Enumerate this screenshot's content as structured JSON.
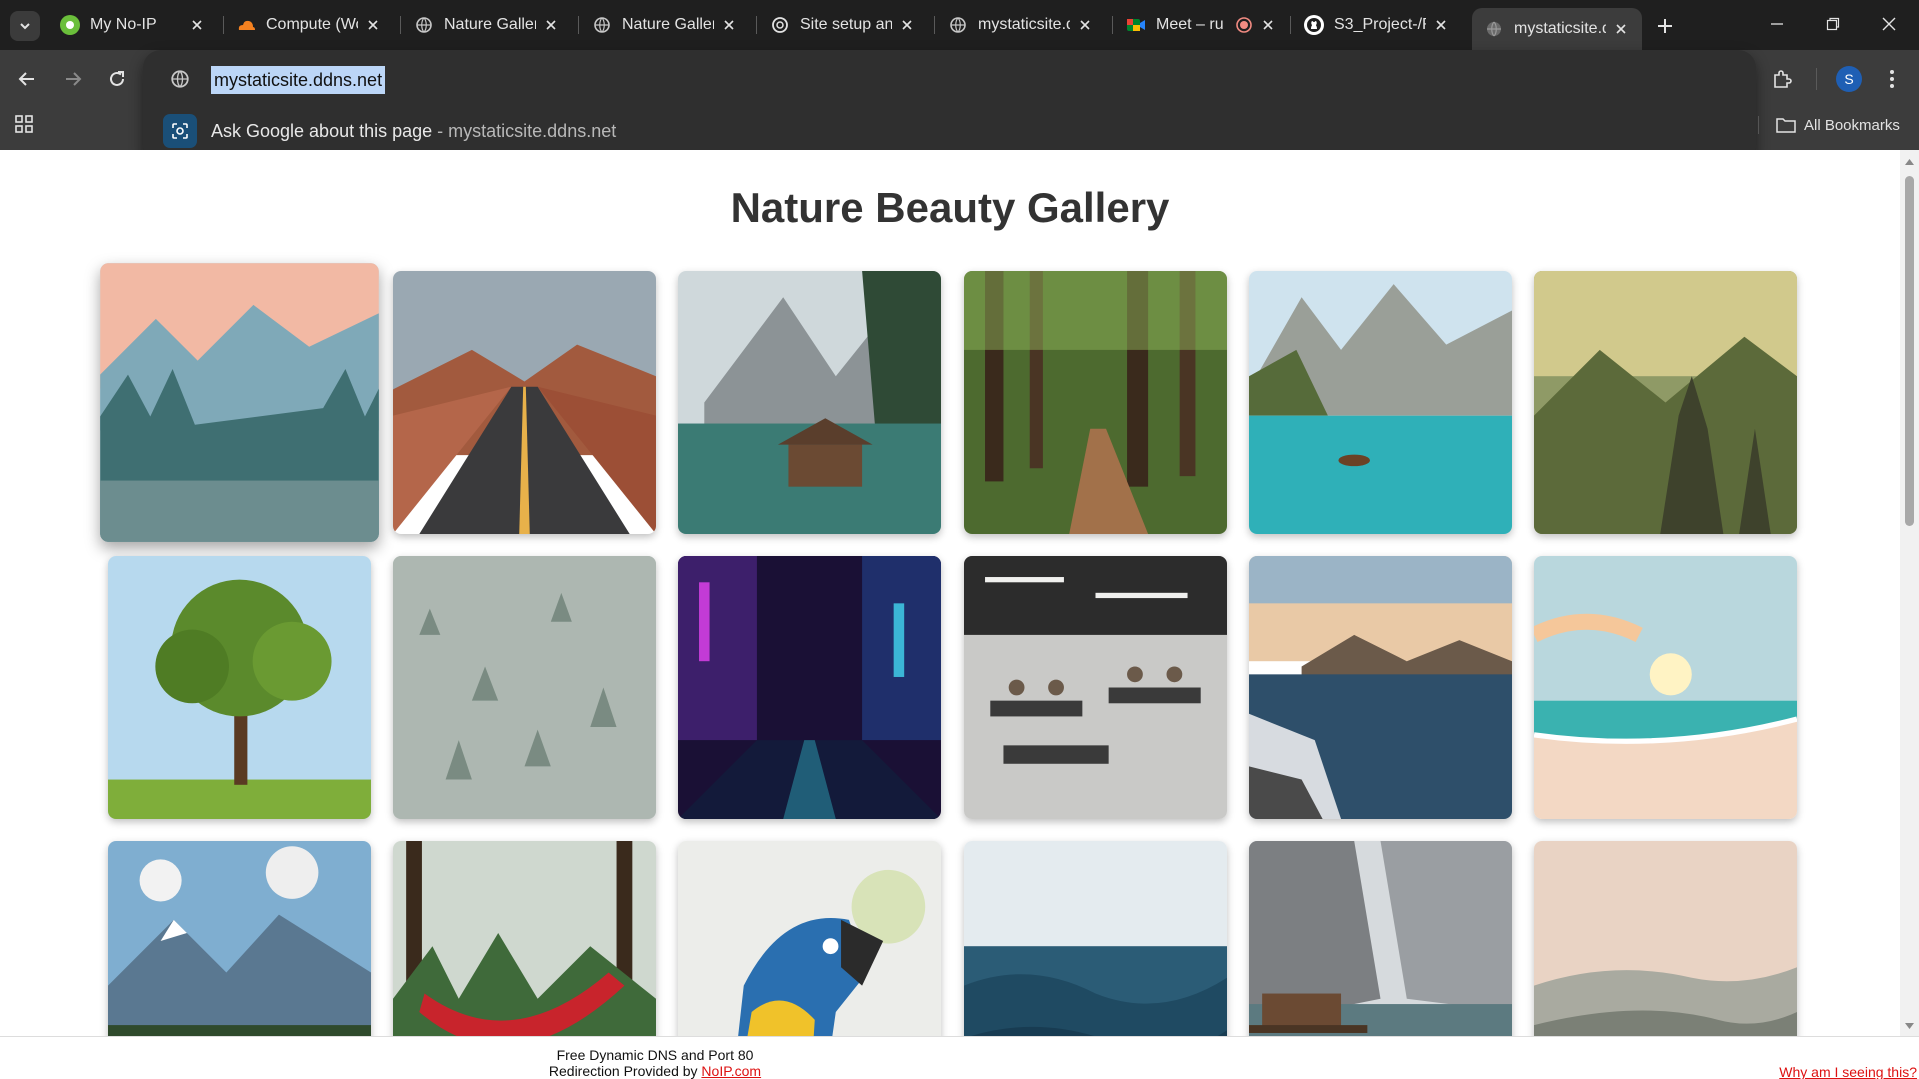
{
  "browser": {
    "tabs": [
      {
        "title": "My No-IP",
        "icon": "noip-favicon"
      },
      {
        "title": "Compute (Wo",
        "icon": "cloudflare-favicon"
      },
      {
        "title": "Nature Galler",
        "icon": "globe-favicon"
      },
      {
        "title": "Nature Galler",
        "icon": "globe-favicon"
      },
      {
        "title": "Site setup an",
        "icon": "openai-favicon"
      },
      {
        "title": "mystaticsite.d",
        "icon": "globe-favicon"
      },
      {
        "title": "Meet – ru",
        "icon": "meet-favicon",
        "recording": true
      },
      {
        "title": "S3_Project-/R",
        "icon": "github-favicon"
      },
      {
        "title": "mystaticsite.d",
        "icon": "globe-favicon",
        "active": true
      }
    ],
    "address_bar": {
      "url": "mystaticsite.ddns.net",
      "suggestion_main": "Ask Google about this page",
      "suggestion_sep": " - ",
      "suggestion_url": "mystaticsite.ddns.net"
    },
    "bookmarks": {
      "all_label": "All Bookmarks"
    },
    "profile_initial": "S",
    "colors": {
      "chrome_dark": "#1f1f1f",
      "toolbar": "#3c3c3c",
      "omnibox": "#2f2f2f",
      "selection": "#bcd6f7"
    }
  },
  "page": {
    "title": "Nature Beauty Gallery",
    "gallery": [
      {
        "name": "mountain-valley-sunrise"
      },
      {
        "name": "desert-road"
      },
      {
        "name": "lake-cabin-mountains"
      },
      {
        "name": "forest-path"
      },
      {
        "name": "turquoise-lake-boat"
      },
      {
        "name": "misty-mountain-peaks"
      },
      {
        "name": "lone-tree"
      },
      {
        "name": "foggy-forest"
      },
      {
        "name": "neon-city-street"
      },
      {
        "name": "open-office"
      },
      {
        "name": "rocky-coast"
      },
      {
        "name": "beach-sunset"
      },
      {
        "name": "alpine-valley"
      },
      {
        "name": "hammock-forest"
      },
      {
        "name": "macaw-parrot"
      },
      {
        "name": "ocean-waves"
      },
      {
        "name": "cliff-lake-dock"
      },
      {
        "name": "hazy-hills"
      }
    ]
  },
  "footer": {
    "line1": "Free Dynamic DNS and Port 80",
    "line2_prefix": "Redirection Provided by ",
    "line2_link": "NoIP.com",
    "why": "Why am I seeing this?"
  }
}
